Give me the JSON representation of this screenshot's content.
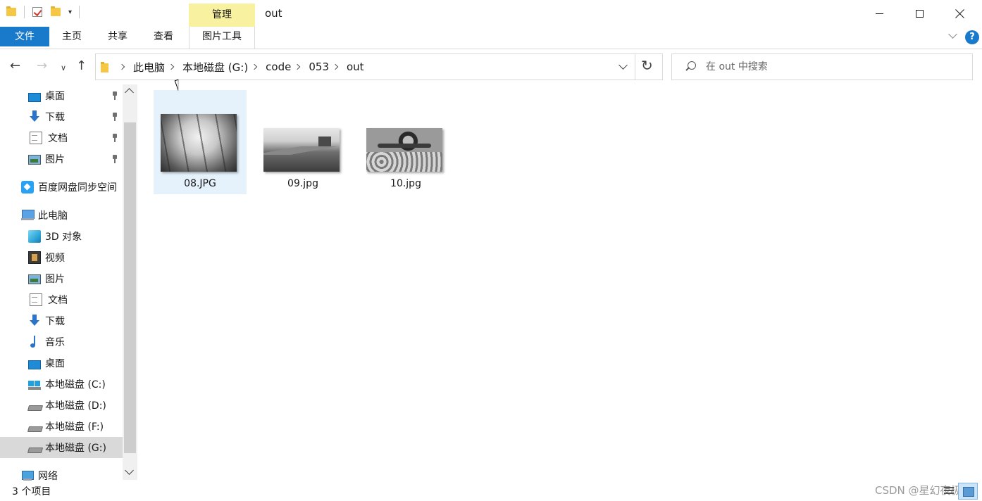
{
  "window": {
    "title": "out",
    "contextual_tab_group": "管理"
  },
  "ribbon": {
    "tabs": [
      "文件",
      "主页",
      "共享",
      "查看",
      "图片工具"
    ],
    "file_tab_color": "#1979ca",
    "manage_color": "#f8f1a0",
    "help_label": "?"
  },
  "address": {
    "breadcrumbs": [
      "此电脑",
      "本地磁盘 (G:)",
      "code",
      "053",
      "out"
    ]
  },
  "search": {
    "placeholder": "在 out 中搜索"
  },
  "sidebar": {
    "quick_access": [
      {
        "label": "桌面",
        "icon": "desktop-icon",
        "pinned": true
      },
      {
        "label": "下载",
        "icon": "download-icon",
        "pinned": true
      },
      {
        "label": "文档",
        "icon": "document-icon",
        "pinned": true
      },
      {
        "label": "图片",
        "icon": "pictures-icon",
        "pinned": true
      }
    ],
    "baidu": {
      "label": "百度网盘同步空间",
      "icon": "baidu-netdisk-icon"
    },
    "this_pc": {
      "label": "此电脑",
      "icon": "computer-icon"
    },
    "pc_items": [
      {
        "label": "3D 对象",
        "icon": "3d-objects-icon"
      },
      {
        "label": "视频",
        "icon": "video-icon"
      },
      {
        "label": "图片",
        "icon": "pictures-icon"
      },
      {
        "label": "文档",
        "icon": "document-icon"
      },
      {
        "label": "下载",
        "icon": "download-icon"
      },
      {
        "label": "音乐",
        "icon": "music-icon"
      },
      {
        "label": "桌面",
        "icon": "desktop-icon"
      },
      {
        "label": "本地磁盘 (C:)",
        "icon": "windows-drive-icon"
      },
      {
        "label": "本地磁盘 (D:)",
        "icon": "drive-icon"
      },
      {
        "label": "本地磁盘 (F:)",
        "icon": "drive-icon"
      },
      {
        "label": "本地磁盘 (G:)",
        "icon": "drive-icon",
        "selected": true
      }
    ],
    "network": {
      "label": "网络",
      "icon": "network-icon"
    }
  },
  "files": [
    {
      "name": "08.JPG",
      "selected": true
    },
    {
      "name": "09.jpg",
      "selected": false
    },
    {
      "name": "10.jpg",
      "selected": false
    }
  ],
  "status": {
    "item_count": "3 个项目",
    "watermark": "CSDN @星幻夜极"
  }
}
